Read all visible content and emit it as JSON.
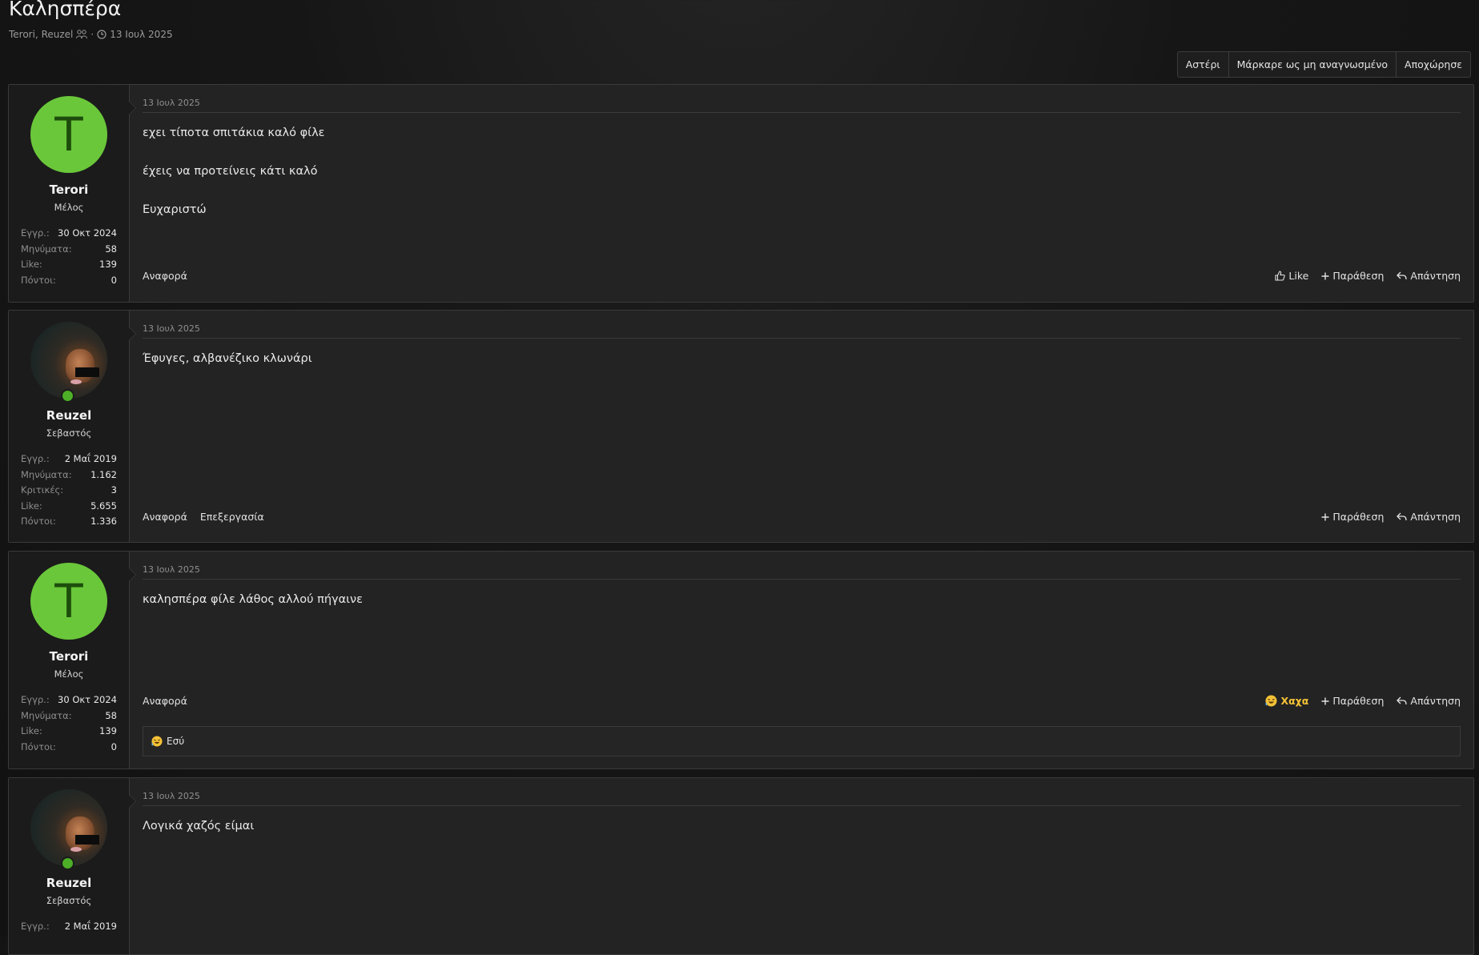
{
  "thread": {
    "title": "Καλησπέρα",
    "participants": "Terori, Reuzel",
    "date": "13 Ιουλ 2025"
  },
  "actions": {
    "star": "Αστέρι",
    "mark_unread": "Μάρκαρε ως μη αναγνωσμένο",
    "leave": "Αποχώρησε"
  },
  "posts": [
    {
      "user": {
        "name": "Terori",
        "avatar_letter": "T",
        "title": "Μέλος",
        "avatar_color": "#6ac73a"
      },
      "stats": [
        {
          "label": "Εγγρ.:",
          "value": "30 Οκτ 2024"
        },
        {
          "label": "Μηνύματα:",
          "value": "58"
        },
        {
          "label": "Like:",
          "value": "139"
        },
        {
          "label": "Πόντοι:",
          "value": "0"
        }
      ],
      "date": "13 Ιουλ 2025",
      "lines": [
        "εχει τίποτα σπιτάκια καλό φίλε",
        "έχεις να προτείνεις κάτι καλό",
        "Ευχαριστώ"
      ],
      "footer": {
        "report": "Αναφορά",
        "like": "Like",
        "quote": "Παράθεση",
        "reply": "Απάντηση"
      }
    },
    {
      "user": {
        "name": "Reuzel",
        "title": "Σεβαστός"
      },
      "stats": [
        {
          "label": "Εγγρ.:",
          "value": "2 Μαΐ 2019"
        },
        {
          "label": "Μηνύματα:",
          "value": "1.162"
        },
        {
          "label": "Κριτικές:",
          "value": "3"
        },
        {
          "label": "Like:",
          "value": "5.655"
        },
        {
          "label": "Πόντοι:",
          "value": "1.336"
        }
      ],
      "date": "13 Ιουλ 2025",
      "lines": [
        "Έφυγες, αλβανέζικο κλωνάρι"
      ],
      "footer": {
        "report": "Αναφορά",
        "edit": "Επεξεργασία",
        "quote": "Παράθεση",
        "reply": "Απάντηση"
      }
    },
    {
      "user": {
        "name": "Terori",
        "avatar_letter": "T",
        "title": "Μέλος",
        "avatar_color": "#6ac73a"
      },
      "stats": [
        {
          "label": "Εγγρ.:",
          "value": "30 Οκτ 2024"
        },
        {
          "label": "Μηνύματα:",
          "value": "58"
        },
        {
          "label": "Like:",
          "value": "139"
        },
        {
          "label": "Πόντοι:",
          "value": "0"
        }
      ],
      "date": "13 Ιουλ 2025",
      "lines": [
        "καλησπέρα φίλε λάθος αλλού πήγαινε"
      ],
      "footer": {
        "report": "Αναφορά",
        "reaction": "Χαχα",
        "quote": "Παράθεση",
        "reply": "Απάντηση"
      },
      "reactions_by": "Εσύ"
    },
    {
      "user": {
        "name": "Reuzel",
        "title": "Σεβαστός"
      },
      "stats": [
        {
          "label": "Εγγρ.:",
          "value": "2 Μαΐ 2019"
        }
      ],
      "date": "13 Ιουλ 2025",
      "lines": [
        "Λογικά χαζός είμαι"
      ]
    }
  ],
  "colors": {
    "background": "#141414",
    "post_bg": "#232323",
    "user_cell_bg": "#1b1b1b",
    "border": "#3a3a3a",
    "avatar_green": "#6ac73a",
    "online_green": "#4caf27",
    "haha_yellow": "#f4c237"
  },
  "icons": [
    "clock-icon",
    "participants-icon",
    "thumbs-up-icon",
    "plus-icon",
    "reply-arrow-icon",
    "haha-emoji-icon",
    "online-status-icon"
  ]
}
